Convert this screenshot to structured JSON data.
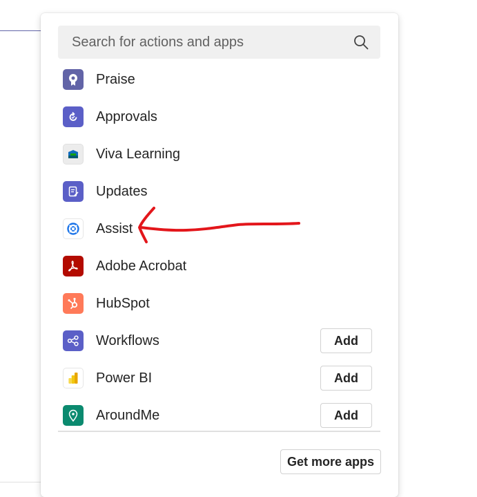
{
  "search": {
    "placeholder": "Search for actions and apps",
    "icon": "search-icon"
  },
  "apps": [
    {
      "label": "Praise",
      "icon": "praise-icon",
      "color": "#6264a7"
    },
    {
      "label": "Approvals",
      "icon": "approvals-icon",
      "color": "#5b5fc7"
    },
    {
      "label": "Viva Learning",
      "icon": "viva-learning-icon",
      "color": "#e8e8e8"
    },
    {
      "label": "Updates",
      "icon": "updates-icon",
      "color": "#5b5fc7"
    },
    {
      "label": "Assist",
      "icon": "assist-icon",
      "color": "#1a73e8"
    },
    {
      "label": "Adobe Acrobat",
      "icon": "adobe-acrobat-icon",
      "color": "#b30b00"
    },
    {
      "label": "HubSpot",
      "icon": "hubspot-icon",
      "color": "#ff7a59"
    },
    {
      "label": "Workflows",
      "icon": "workflows-icon",
      "color": "#5b5fc7",
      "action": "Add"
    },
    {
      "label": "Power BI",
      "icon": "power-bi-icon",
      "color": "#f2c811",
      "action": "Add"
    },
    {
      "label": "AroundMe",
      "icon": "aroundme-icon",
      "color": "#0b8a6f",
      "action": "Add"
    }
  ],
  "footer": {
    "get_more_label": "Get more apps"
  },
  "annotation": {
    "color": "#e3161b"
  }
}
